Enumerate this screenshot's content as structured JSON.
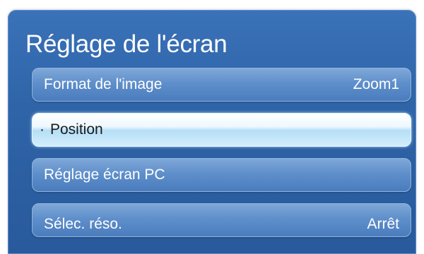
{
  "screen": {
    "title": "Réglage de l'écran"
  },
  "menu": {
    "items": [
      {
        "label": "Format de l'image",
        "value": "Zoom1"
      },
      {
        "bullet": "·",
        "label": "Position",
        "value": ""
      },
      {
        "label": "Réglage écran PC",
        "value": ""
      },
      {
        "label": "Sélec. réso.",
        "value": "Arrêt"
      }
    ]
  },
  "colors": {
    "panel": "#2f64a8",
    "item": "#5f8fcb",
    "selected_item": "#d3eefb",
    "selected_text": "#1a1a1a",
    "text": "#ffffff"
  }
}
